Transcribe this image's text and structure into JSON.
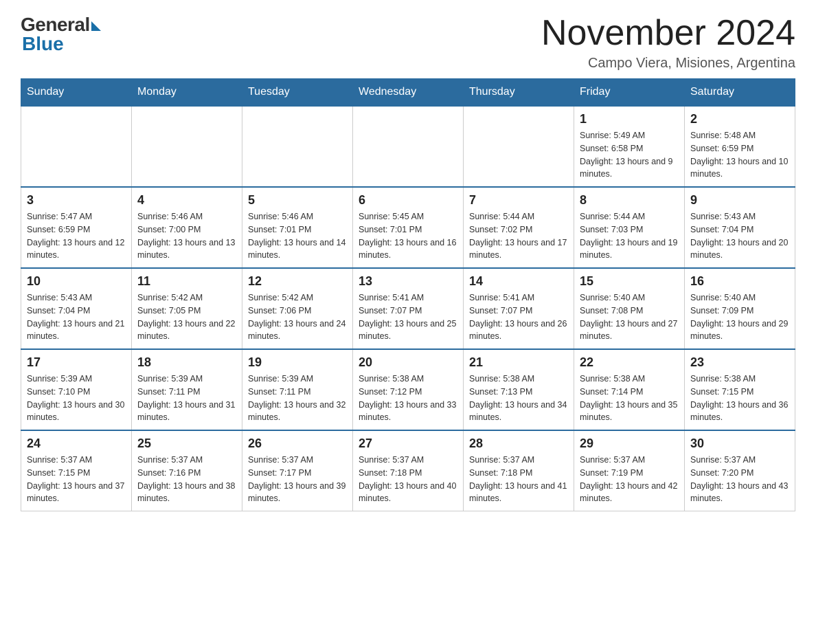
{
  "logo": {
    "general": "General",
    "blue": "Blue"
  },
  "title": {
    "month_year": "November 2024",
    "location": "Campo Viera, Misiones, Argentina"
  },
  "days_of_week": [
    "Sunday",
    "Monday",
    "Tuesday",
    "Wednesday",
    "Thursday",
    "Friday",
    "Saturday"
  ],
  "weeks": [
    [
      {
        "day": "",
        "sunrise": "",
        "sunset": "",
        "daylight": ""
      },
      {
        "day": "",
        "sunrise": "",
        "sunset": "",
        "daylight": ""
      },
      {
        "day": "",
        "sunrise": "",
        "sunset": "",
        "daylight": ""
      },
      {
        "day": "",
        "sunrise": "",
        "sunset": "",
        "daylight": ""
      },
      {
        "day": "",
        "sunrise": "",
        "sunset": "",
        "daylight": ""
      },
      {
        "day": "1",
        "sunrise": "Sunrise: 5:49 AM",
        "sunset": "Sunset: 6:58 PM",
        "daylight": "Daylight: 13 hours and 9 minutes."
      },
      {
        "day": "2",
        "sunrise": "Sunrise: 5:48 AM",
        "sunset": "Sunset: 6:59 PM",
        "daylight": "Daylight: 13 hours and 10 minutes."
      }
    ],
    [
      {
        "day": "3",
        "sunrise": "Sunrise: 5:47 AM",
        "sunset": "Sunset: 6:59 PM",
        "daylight": "Daylight: 13 hours and 12 minutes."
      },
      {
        "day": "4",
        "sunrise": "Sunrise: 5:46 AM",
        "sunset": "Sunset: 7:00 PM",
        "daylight": "Daylight: 13 hours and 13 minutes."
      },
      {
        "day": "5",
        "sunrise": "Sunrise: 5:46 AM",
        "sunset": "Sunset: 7:01 PM",
        "daylight": "Daylight: 13 hours and 14 minutes."
      },
      {
        "day": "6",
        "sunrise": "Sunrise: 5:45 AM",
        "sunset": "Sunset: 7:01 PM",
        "daylight": "Daylight: 13 hours and 16 minutes."
      },
      {
        "day": "7",
        "sunrise": "Sunrise: 5:44 AM",
        "sunset": "Sunset: 7:02 PM",
        "daylight": "Daylight: 13 hours and 17 minutes."
      },
      {
        "day": "8",
        "sunrise": "Sunrise: 5:44 AM",
        "sunset": "Sunset: 7:03 PM",
        "daylight": "Daylight: 13 hours and 19 minutes."
      },
      {
        "day": "9",
        "sunrise": "Sunrise: 5:43 AM",
        "sunset": "Sunset: 7:04 PM",
        "daylight": "Daylight: 13 hours and 20 minutes."
      }
    ],
    [
      {
        "day": "10",
        "sunrise": "Sunrise: 5:43 AM",
        "sunset": "Sunset: 7:04 PM",
        "daylight": "Daylight: 13 hours and 21 minutes."
      },
      {
        "day": "11",
        "sunrise": "Sunrise: 5:42 AM",
        "sunset": "Sunset: 7:05 PM",
        "daylight": "Daylight: 13 hours and 22 minutes."
      },
      {
        "day": "12",
        "sunrise": "Sunrise: 5:42 AM",
        "sunset": "Sunset: 7:06 PM",
        "daylight": "Daylight: 13 hours and 24 minutes."
      },
      {
        "day": "13",
        "sunrise": "Sunrise: 5:41 AM",
        "sunset": "Sunset: 7:07 PM",
        "daylight": "Daylight: 13 hours and 25 minutes."
      },
      {
        "day": "14",
        "sunrise": "Sunrise: 5:41 AM",
        "sunset": "Sunset: 7:07 PM",
        "daylight": "Daylight: 13 hours and 26 minutes."
      },
      {
        "day": "15",
        "sunrise": "Sunrise: 5:40 AM",
        "sunset": "Sunset: 7:08 PM",
        "daylight": "Daylight: 13 hours and 27 minutes."
      },
      {
        "day": "16",
        "sunrise": "Sunrise: 5:40 AM",
        "sunset": "Sunset: 7:09 PM",
        "daylight": "Daylight: 13 hours and 29 minutes."
      }
    ],
    [
      {
        "day": "17",
        "sunrise": "Sunrise: 5:39 AM",
        "sunset": "Sunset: 7:10 PM",
        "daylight": "Daylight: 13 hours and 30 minutes."
      },
      {
        "day": "18",
        "sunrise": "Sunrise: 5:39 AM",
        "sunset": "Sunset: 7:11 PM",
        "daylight": "Daylight: 13 hours and 31 minutes."
      },
      {
        "day": "19",
        "sunrise": "Sunrise: 5:39 AM",
        "sunset": "Sunset: 7:11 PM",
        "daylight": "Daylight: 13 hours and 32 minutes."
      },
      {
        "day": "20",
        "sunrise": "Sunrise: 5:38 AM",
        "sunset": "Sunset: 7:12 PM",
        "daylight": "Daylight: 13 hours and 33 minutes."
      },
      {
        "day": "21",
        "sunrise": "Sunrise: 5:38 AM",
        "sunset": "Sunset: 7:13 PM",
        "daylight": "Daylight: 13 hours and 34 minutes."
      },
      {
        "day": "22",
        "sunrise": "Sunrise: 5:38 AM",
        "sunset": "Sunset: 7:14 PM",
        "daylight": "Daylight: 13 hours and 35 minutes."
      },
      {
        "day": "23",
        "sunrise": "Sunrise: 5:38 AM",
        "sunset": "Sunset: 7:15 PM",
        "daylight": "Daylight: 13 hours and 36 minutes."
      }
    ],
    [
      {
        "day": "24",
        "sunrise": "Sunrise: 5:37 AM",
        "sunset": "Sunset: 7:15 PM",
        "daylight": "Daylight: 13 hours and 37 minutes."
      },
      {
        "day": "25",
        "sunrise": "Sunrise: 5:37 AM",
        "sunset": "Sunset: 7:16 PM",
        "daylight": "Daylight: 13 hours and 38 minutes."
      },
      {
        "day": "26",
        "sunrise": "Sunrise: 5:37 AM",
        "sunset": "Sunset: 7:17 PM",
        "daylight": "Daylight: 13 hours and 39 minutes."
      },
      {
        "day": "27",
        "sunrise": "Sunrise: 5:37 AM",
        "sunset": "Sunset: 7:18 PM",
        "daylight": "Daylight: 13 hours and 40 minutes."
      },
      {
        "day": "28",
        "sunrise": "Sunrise: 5:37 AM",
        "sunset": "Sunset: 7:18 PM",
        "daylight": "Daylight: 13 hours and 41 minutes."
      },
      {
        "day": "29",
        "sunrise": "Sunrise: 5:37 AM",
        "sunset": "Sunset: 7:19 PM",
        "daylight": "Daylight: 13 hours and 42 minutes."
      },
      {
        "day": "30",
        "sunrise": "Sunrise: 5:37 AM",
        "sunset": "Sunset: 7:20 PM",
        "daylight": "Daylight: 13 hours and 43 minutes."
      }
    ]
  ]
}
